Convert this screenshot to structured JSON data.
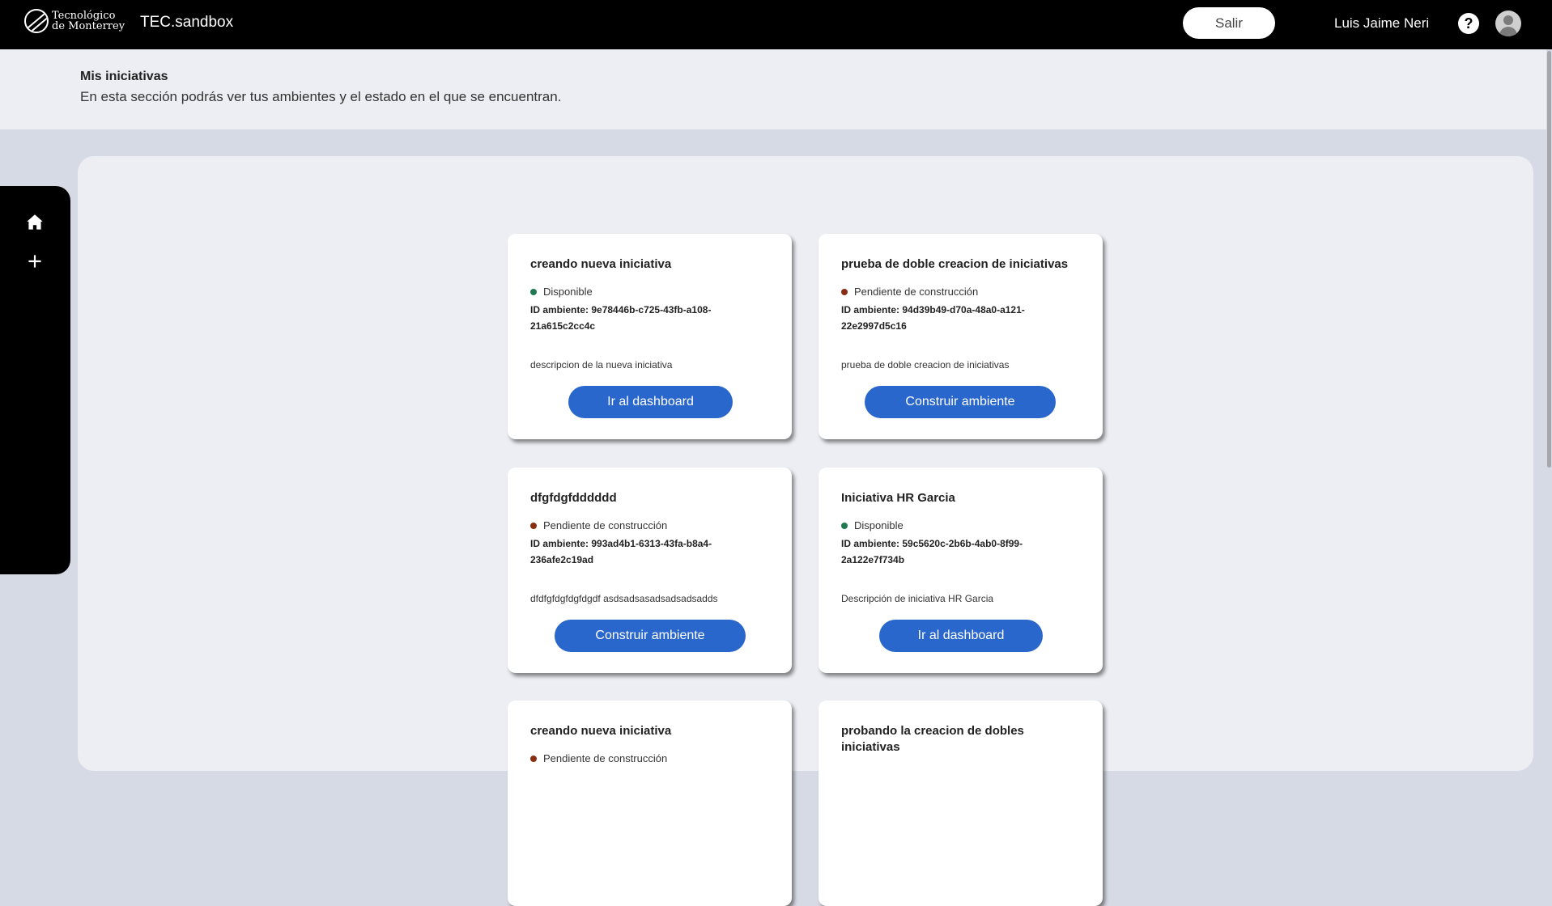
{
  "topbar": {
    "logo_line1": "Tecnológico",
    "logo_line2": "de Monterrey",
    "app_name": "TEC.sandbox",
    "logout_label": "Salir",
    "user_name": "Luis Jaime Neri",
    "help_symbol": "?"
  },
  "header": {
    "title": "Mis iniciativas",
    "subtitle": "En esta sección podrás ver tus ambientes y el estado en el que se encuentran."
  },
  "sidebar": {
    "items": [
      {
        "icon": "home-icon"
      },
      {
        "icon": "plus-icon"
      }
    ]
  },
  "colors": {
    "status_available": "#1f7a4f",
    "status_pending": "#8a2e12",
    "button": "#2a67cc"
  },
  "cards": [
    {
      "title": "creando nueva iniciativa",
      "status": "Disponible",
      "status_color": "#1f7a4f",
      "id_line": "ID ambiente: 9e78446b-c725-43fb-a108-21a615c2cc4c",
      "description": "descripcion de la nueva iniciativa",
      "button": "Ir al dashboard"
    },
    {
      "title": "prueba de doble creacion de iniciativas",
      "status": "Pendiente de construcción",
      "status_color": "#8a2e12",
      "id_line": "ID ambiente: 94d39b49-d70a-48a0-a121-22e2997d5c16",
      "description": "prueba de doble creacion de iniciativas",
      "button": "Construir ambiente"
    },
    {
      "title": "dfgfdgfdddddd",
      "status": "Pendiente de construcción",
      "status_color": "#8a2e12",
      "id_line": "ID ambiente: 993ad4b1-6313-43fa-b8a4-236afe2c19ad",
      "description": "dfdfgfdgfdgfdgdf asdsadsasadsadsadsadds",
      "button": "Construir ambiente"
    },
    {
      "title": "Iniciativa HR Garcia",
      "status": "Disponible",
      "status_color": "#1f7a4f",
      "id_line": "ID ambiente: 59c5620c-2b6b-4ab0-8f99-2a122e7f734b",
      "description": "Descripción de iniciativa HR Garcia",
      "button": "Ir al dashboard"
    },
    {
      "title": "creando nueva iniciativa",
      "status": "Pendiente de construcción",
      "status_color": "#8a2e12"
    },
    {
      "title": "probando la creacion de dobles iniciativas"
    }
  ]
}
